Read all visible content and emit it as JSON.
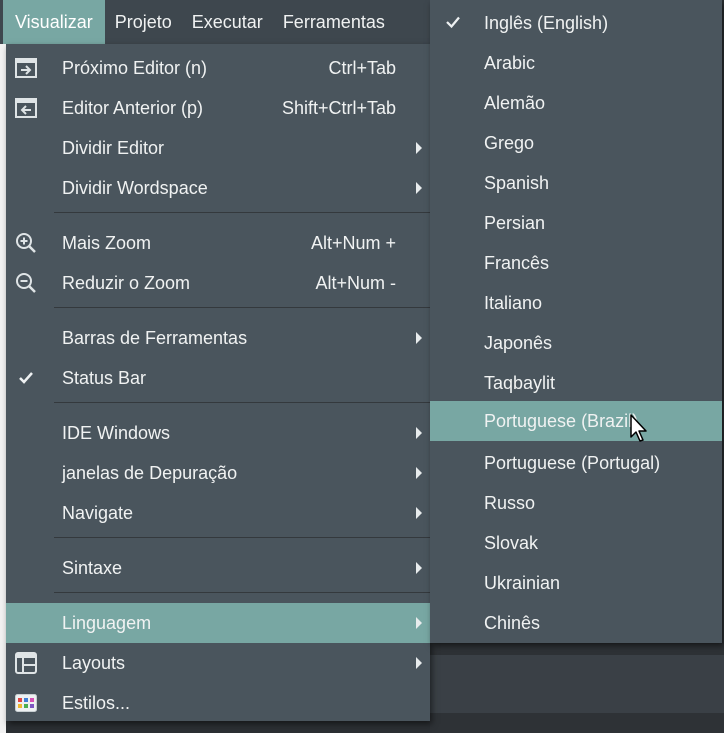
{
  "menubar": {
    "items": [
      "Visualizar",
      "Projeto",
      "Executar",
      "Ferramentas"
    ]
  },
  "view_menu": {
    "items": [
      {
        "label": "Próximo Editor (n)",
        "shortcut": "Ctrl+Tab",
        "icon": "next-editor-icon"
      },
      {
        "label": "Editor Anterior (p)",
        "shortcut": "Shift+Ctrl+Tab",
        "icon": "previous-editor-icon"
      },
      {
        "label": "Dividir Editor",
        "submenu": true
      },
      {
        "label": "Dividir Wordspace",
        "submenu": true
      },
      {
        "label": "Mais Zoom",
        "shortcut": "Alt+Num +",
        "icon": "zoom-in-icon"
      },
      {
        "label": "Reduzir o Zoom",
        "shortcut": "Alt+Num -",
        "icon": "zoom-out-icon"
      },
      {
        "label": "Barras de Ferramentas",
        "submenu": true
      },
      {
        "label": "Status Bar",
        "checked": true
      },
      {
        "label": "IDE Windows",
        "submenu": true
      },
      {
        "label": "janelas de Depuração",
        "submenu": true
      },
      {
        "label": "Navigate",
        "submenu": true
      },
      {
        "label": "Sintaxe",
        "submenu": true
      },
      {
        "label": "Linguagem",
        "submenu": true,
        "highlighted": true
      },
      {
        "label": "Layouts",
        "submenu": true,
        "icon": "layouts-icon"
      },
      {
        "label": "Estilos...",
        "icon": "styles-icon"
      }
    ]
  },
  "language_menu": {
    "items": [
      {
        "label": "Inglês (English)",
        "checked": true
      },
      {
        "label": "Arabic"
      },
      {
        "label": "Alemão"
      },
      {
        "label": "Grego"
      },
      {
        "label": "Spanish"
      },
      {
        "label": "Persian"
      },
      {
        "label": "Francês"
      },
      {
        "label": "Italiano"
      },
      {
        "label": "Japonês"
      },
      {
        "label": "Taqbaylit"
      },
      {
        "label": "Portuguese (Brazil)",
        "highlighted": true
      },
      {
        "label": "Portuguese (Portugal)"
      },
      {
        "label": "Russo"
      },
      {
        "label": "Slovak"
      },
      {
        "label": "Ukrainian"
      },
      {
        "label": "Chinês"
      }
    ]
  },
  "colors": {
    "menu_bg": "#4a555d",
    "highlight": "#78a7a3",
    "menubar_bg": "#3e474e",
    "text": "#f0f2f2"
  }
}
